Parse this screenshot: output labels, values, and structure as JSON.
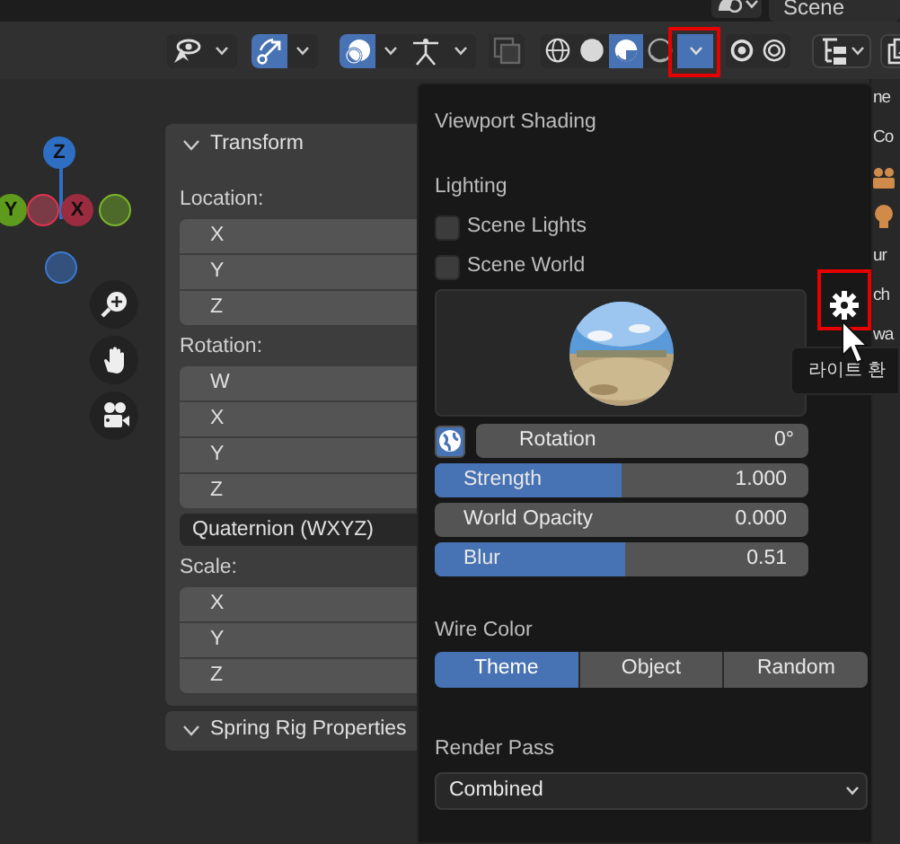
{
  "header": {
    "scene": "Scene"
  },
  "toolbar": [
    {
      "kind": "visibility",
      "selected": false,
      "menu": true
    },
    {
      "kind": "gizmo",
      "selected": true,
      "menu": true
    },
    {
      "kind": "overlay",
      "selected": true,
      "menu": true
    },
    {
      "kind": "bone",
      "selected": false,
      "menu": true
    },
    {
      "kind": "xray",
      "selected": false,
      "menu": false
    }
  ],
  "shading": [
    {
      "kind": "wireframe",
      "selected": false
    },
    {
      "kind": "solid",
      "selected": false
    },
    {
      "kind": "material",
      "selected": true
    },
    {
      "kind": "rendered",
      "selected": false
    }
  ],
  "shading_menu": {
    "expanded": true,
    "highlighted": true
  },
  "extra_buttons": [
    {
      "kind": "ring"
    },
    {
      "kind": "rings"
    }
  ],
  "outliner_buttons": [
    {
      "kind": "filter",
      "menu": true
    },
    {
      "kind": "display",
      "menu": true
    }
  ],
  "gizmo_axes": [
    {
      "label": "Z",
      "color": "#2e6fc4"
    },
    {
      "label": "X",
      "color": "#9b2b3e"
    },
    {
      "label": "Y",
      "color": "#5e9a1c"
    }
  ],
  "transform": {
    "title": "Transform",
    "expanded": true,
    "groups": [
      {
        "label": "Location:",
        "fields": [
          "X",
          "Y",
          "Z"
        ]
      },
      {
        "label": "Rotation:",
        "fields": [
          "W",
          "X",
          "Y",
          "Z"
        ],
        "mode": "Quaternion (WXYZ)"
      },
      {
        "label": "Scale:",
        "fields": [
          "X",
          "Y",
          "Z"
        ]
      }
    ]
  },
  "panels": [
    {
      "title": "Spring Rig Properties",
      "expanded": true
    }
  ],
  "shading_popover": {
    "title": "Viewport Shading",
    "lighting": {
      "label": "Lighting",
      "options": [
        {
          "label": "Scene Lights",
          "checked": false
        },
        {
          "label": "Scene World",
          "checked": false
        }
      ],
      "settings_button": {
        "highlighted": true
      },
      "tooltip": "라이트 환",
      "world_space": {
        "selected": true
      },
      "fields": [
        {
          "kind": "field",
          "label": "Rotation",
          "value": "0°"
        },
        {
          "kind": "slider",
          "label": "Strength",
          "value": "1.000",
          "level": 0.5
        },
        {
          "kind": "slider",
          "label": "World Opacity",
          "value": "0.000",
          "level": 0
        },
        {
          "kind": "slider",
          "label": "Blur",
          "value": "0.51",
          "level": 0.51
        }
      ]
    },
    "wire_color": {
      "label": "Wire Color",
      "options": [
        {
          "label": "Theme",
          "selected": true
        },
        {
          "label": "Object",
          "selected": false
        },
        {
          "label": "Random",
          "selected": false
        }
      ]
    },
    "render_pass": {
      "label": "Render Pass",
      "value": "Combined"
    }
  },
  "outliner": [
    "ne",
    "Co",
    {
      "kind": "camera"
    },
    {
      "kind": "light"
    },
    "ur",
    "ch",
    "wa"
  ]
}
